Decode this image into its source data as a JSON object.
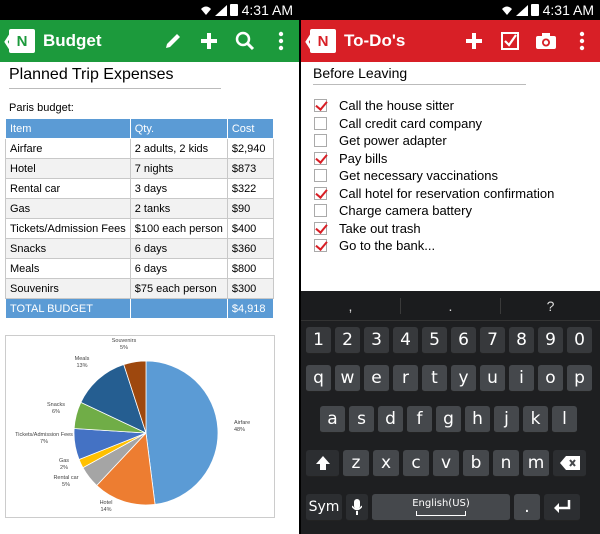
{
  "left": {
    "status": {
      "time": "4:31 AM"
    },
    "appbar": {
      "back": "❮",
      "logo_letter": "N",
      "title": "Budget",
      "icons": [
        "pencil-icon",
        "plus-icon",
        "search-icon",
        "overflow-menu-icon"
      ],
      "color": "#1c9a3c"
    },
    "doc_title": "Planned Trip Expenses",
    "subtitle": "Paris budget:",
    "table": {
      "headers": [
        "Item",
        "Qty.",
        "Cost"
      ],
      "rows": [
        [
          "Airfare",
          "2 adults, 2 kids",
          "$2,940"
        ],
        [
          "Hotel",
          "7 nights",
          "$873"
        ],
        [
          "Rental car",
          "3 days",
          "$322"
        ],
        [
          "Gas",
          "2 tanks",
          "$90"
        ],
        [
          "Tickets/Admission Fees",
          "$100 each person",
          "$400"
        ],
        [
          "Snacks",
          "6 days",
          "$360"
        ],
        [
          "Meals",
          "6 days",
          "$800"
        ],
        [
          "Souvenirs",
          "$75 each person",
          "$300"
        ]
      ],
      "total": [
        "TOTAL BUDGET",
        "",
        "$4,918"
      ],
      "header_color": "#5b9bd5"
    },
    "chart_data": {
      "type": "pie",
      "slices": [
        {
          "label": "Airfare",
          "value": 48,
          "pct": "48%",
          "color": "#5b9bd5"
        },
        {
          "label": "Hotel",
          "value": 14,
          "pct": "14%",
          "color": "#ed7d31"
        },
        {
          "label": "Rental car",
          "value": 5,
          "pct": "5%",
          "color": "#a5a5a5"
        },
        {
          "label": "Gas",
          "value": 2,
          "pct": "2%",
          "color": "#ffc000"
        },
        {
          "label": "Tickets/Admission Fees",
          "value": 7,
          "pct": "7%",
          "color": "#4472c4"
        },
        {
          "label": "Snacks",
          "value": 6,
          "pct": "6%",
          "color": "#70ad47"
        },
        {
          "label": "Meals",
          "value": 13,
          "pct": "13%",
          "color": "#255e91"
        },
        {
          "label": "Souvenirs",
          "value": 5,
          "pct": "5%",
          "color": "#9e480e"
        }
      ]
    }
  },
  "right": {
    "status": {
      "time": "4:31 AM"
    },
    "appbar": {
      "back": "❮",
      "logo_letter": "N",
      "title": "To-Do's",
      "icons": [
        "plus-icon",
        "checkbox-icon",
        "camera-icon",
        "overflow-menu-icon"
      ],
      "color": "#d81f26"
    },
    "list_title": "Before Leaving",
    "items": [
      {
        "text": "Call the house sitter",
        "checked": true
      },
      {
        "text": "Call credit card company",
        "checked": false
      },
      {
        "text": "Get power adapter",
        "checked": false
      },
      {
        "text": "Pay bills",
        "checked": true
      },
      {
        "text": "Get necessary vaccinations",
        "checked": false
      },
      {
        "text": "Call hotel for reservation confirmation",
        "checked": true
      },
      {
        "text": "Charge camera battery",
        "checked": false
      },
      {
        "text": "Take out trash",
        "checked": true
      },
      {
        "text": "Go to the bank...",
        "checked": true
      }
    ],
    "keyboard": {
      "suggestions": [
        ",",
        ".",
        "?"
      ],
      "rows": [
        [
          "1",
          "2",
          "3",
          "4",
          "5",
          "6",
          "7",
          "8",
          "9",
          "0"
        ],
        [
          "q",
          "w",
          "e",
          "r",
          "t",
          "y",
          "u",
          "i",
          "o",
          "p"
        ],
        [
          "a",
          "s",
          "d",
          "f",
          "g",
          "h",
          "j",
          "k",
          "l"
        ],
        [
          "z",
          "x",
          "c",
          "v",
          "b",
          "n",
          "m"
        ]
      ],
      "sym_label": "Sym",
      "space_label": "English(US)",
      "period": "."
    }
  }
}
